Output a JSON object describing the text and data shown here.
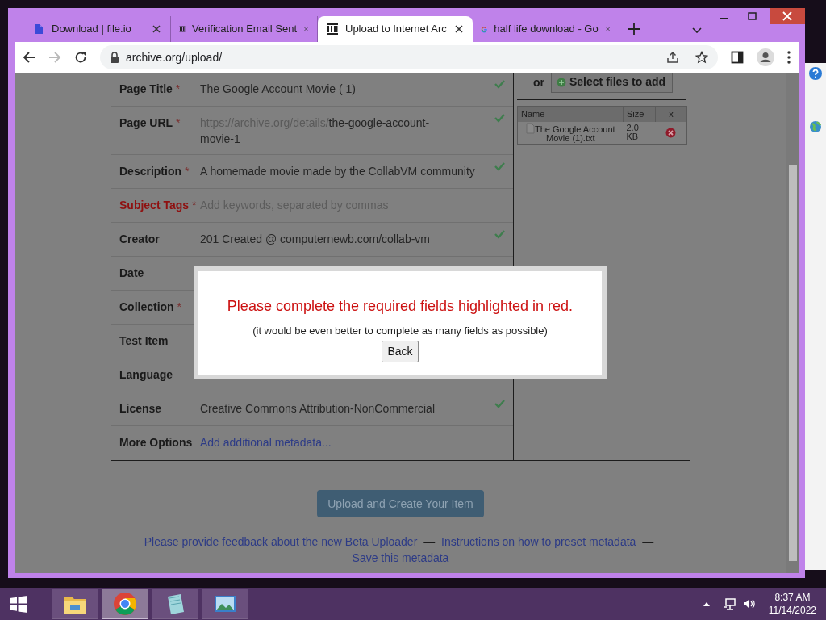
{
  "browser": {
    "tabs": [
      {
        "title": "Download | file.io",
        "kind": "fileio",
        "selected": false
      },
      {
        "title": "Verification Email Sent",
        "kind": "archive",
        "selected": false
      },
      {
        "title": "Upload to Internet Arc",
        "kind": "archive",
        "selected": true
      },
      {
        "title": "half life download - Go",
        "kind": "google",
        "selected": false
      }
    ],
    "forward_enabled": false,
    "address": "archive.org/upload/"
  },
  "form": {
    "rows": [
      {
        "label": "Page Title",
        "mark": "*",
        "invalid": false,
        "kind": "text",
        "value": "The Google Account Movie ( 1)",
        "valid": true
      },
      {
        "label": "Page URL",
        "mark": "*",
        "invalid": false,
        "kind": "url",
        "prefix": "https://archive.org/details/",
        "value": "the-google-account-movie-1",
        "valid": true
      },
      {
        "label": "Description",
        "mark": "*",
        "invalid": false,
        "kind": "text",
        "value": "A homemade movie made by the CollabVM community",
        "valid": true
      },
      {
        "label": "Subject Tags",
        "mark": "*",
        "invalid": true,
        "kind": "input",
        "placeholder": "Add keywords, separated by commas",
        "valid": false
      },
      {
        "label": "Creator",
        "invalid": false,
        "kind": "text",
        "value": "201 Created @ computernewb.com/collab-vm",
        "valid": true
      },
      {
        "label": "Date",
        "invalid": false,
        "kind": "hidden",
        "valid": false
      },
      {
        "label": "Collection",
        "mark": "*",
        "invalid": false,
        "kind": "hidden",
        "valid": false
      },
      {
        "label": "Test Item",
        "invalid": false,
        "kind": "hidden",
        "valid": false
      },
      {
        "label": "Language",
        "invalid": false,
        "kind": "hidden",
        "valid": false
      },
      {
        "label": "License",
        "invalid": false,
        "kind": "text",
        "value": "Creative Commons Attribution-NonCommercial",
        "valid": true
      },
      {
        "label": "More Options",
        "invalid": false,
        "kind": "link",
        "value": "Add additional metadata...",
        "valid": false
      }
    ]
  },
  "files": {
    "or": "or",
    "select_button": "Select files to add",
    "columns": [
      "Name",
      "Size",
      "x"
    ],
    "rows": [
      {
        "name": "The Google Account Movie (1).txt",
        "size": "2.0 KB"
      }
    ]
  },
  "upload_button": "Upload and Create Your Item",
  "footer": [
    {
      "kind": "link",
      "text": "Please provide feedback about the new Beta Uploader"
    },
    {
      "kind": "sep",
      "text": "—"
    },
    {
      "kind": "link",
      "text": "Instructions on how to preset metadata"
    },
    {
      "kind": "sep",
      "text": "—"
    },
    {
      "kind": "link",
      "text": "Save this metadata"
    }
  ],
  "modal": {
    "message": "Please complete the required fields highlighted in red.",
    "note": "(it would be even better to complete as many fields as possible)",
    "button": "Back"
  },
  "taskbar": {
    "apps": [
      {
        "kind": "folder",
        "selected": false
      },
      {
        "kind": "browser",
        "selected": true
      },
      {
        "kind": "note",
        "selected": false
      },
      {
        "kind": "photo",
        "selected": false
      }
    ],
    "time": "8:37 AM",
    "date": "11/14/2022"
  }
}
